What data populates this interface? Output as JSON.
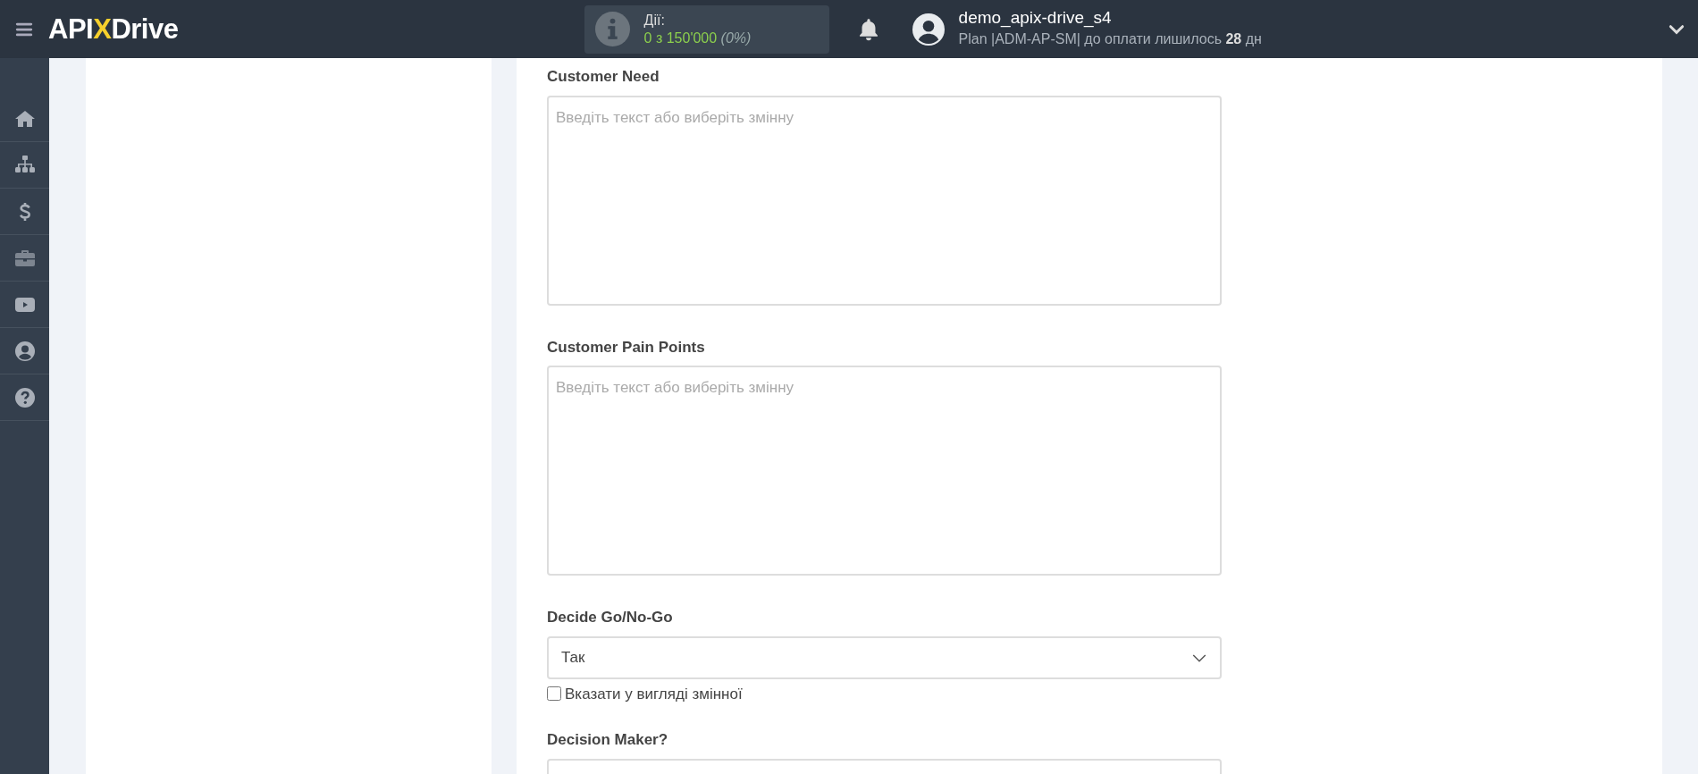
{
  "header": {
    "logo": {
      "part1": "API",
      "part2": "X",
      "part3": "Drive"
    },
    "actions": {
      "label": "Дії:",
      "count": "0 з 150'000",
      "percent": "(0%)"
    },
    "user": {
      "name": "demo_apix-drive_s4",
      "plan": "Plan |ADM-AP-SM| до оплати лишилось ",
      "days": "28",
      "unit": " дн"
    }
  },
  "form": {
    "fields": [
      {
        "kind": "textarea",
        "label": "Customer Need",
        "placeholder": "Введіть текст або виберіть змінну"
      },
      {
        "kind": "textarea",
        "label": "Customer Pain Points",
        "placeholder": "Введіть текст або виберіть змінну"
      },
      {
        "kind": "select",
        "label": "Decide Go/No-Go",
        "value": "Так",
        "variable_label": "Вказати у вигляді змінної",
        "variable_checked": false
      },
      {
        "kind": "select",
        "label": "Decision Maker?"
      }
    ]
  }
}
